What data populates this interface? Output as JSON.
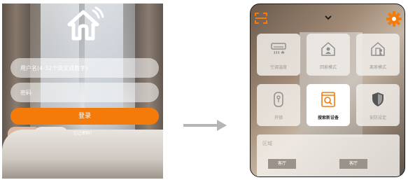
{
  "login": {
    "username_placeholder": "用户名(4-32个英文或数字)",
    "password_placeholder": "密码",
    "login_label": "登录",
    "forgot_label": "忘记密码?",
    "accent": "#f47a0a"
  },
  "home": {
    "tiles": [
      {
        "label": "空调温度",
        "icon": "air-conditioner-icon"
      },
      {
        "label": "回家模式",
        "icon": "home-mode-icon"
      },
      {
        "label": "离家模式",
        "icon": "leave-home-icon"
      },
      {
        "label": "开锁",
        "icon": "door-lock-icon"
      },
      {
        "label": "搜索新设备",
        "icon": "search-device-icon"
      },
      {
        "label": "安防设定",
        "icon": "shield-icon"
      }
    ],
    "zone": {
      "label": "区域",
      "chips": [
        "客厅",
        "客厅"
      ]
    },
    "accent": "#f47a0a"
  }
}
